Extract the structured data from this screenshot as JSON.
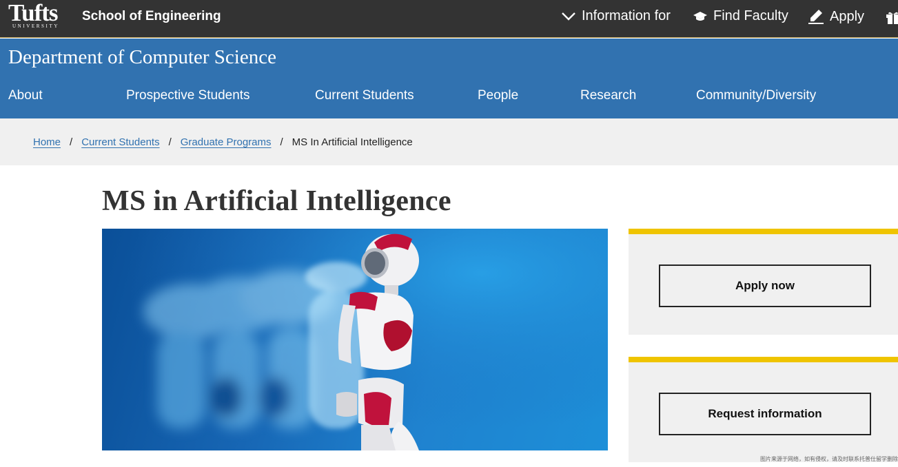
{
  "topbar": {
    "logo": "Tufts",
    "logo_sub": "UNIVERSITY",
    "school": "School of Engineering",
    "nav": [
      {
        "label": "Information for",
        "icon": "chevron-down-icon"
      },
      {
        "label": "Find Faculty",
        "icon": "graduation-cap-icon"
      },
      {
        "label": "Apply",
        "icon": "pencil-icon"
      }
    ],
    "gift_icon": "gift-icon"
  },
  "dept": {
    "title": "Department of Computer Science",
    "nav": [
      "About",
      "Prospective Students",
      "Current Students",
      "People",
      "Research",
      "Community/Diversity"
    ]
  },
  "breadcrumb": {
    "items": [
      "Home",
      "Current Students",
      "Graduate Programs"
    ],
    "separator": "/",
    "current": "MS In Artificial Intelligence"
  },
  "page": {
    "title": "MS in Artificial Intelligence",
    "hero_image": "robot-image"
  },
  "cta": {
    "apply_label": "Apply now",
    "request_label": "Request information"
  },
  "watermark": "图片来源于网络，如有侵权，请及时联系托普仕留学删除",
  "colors": {
    "topbar": "#333333",
    "brand_blue": "#3172b0",
    "accent_yellow": "#efc400",
    "band_gray": "#f0f0f0"
  }
}
